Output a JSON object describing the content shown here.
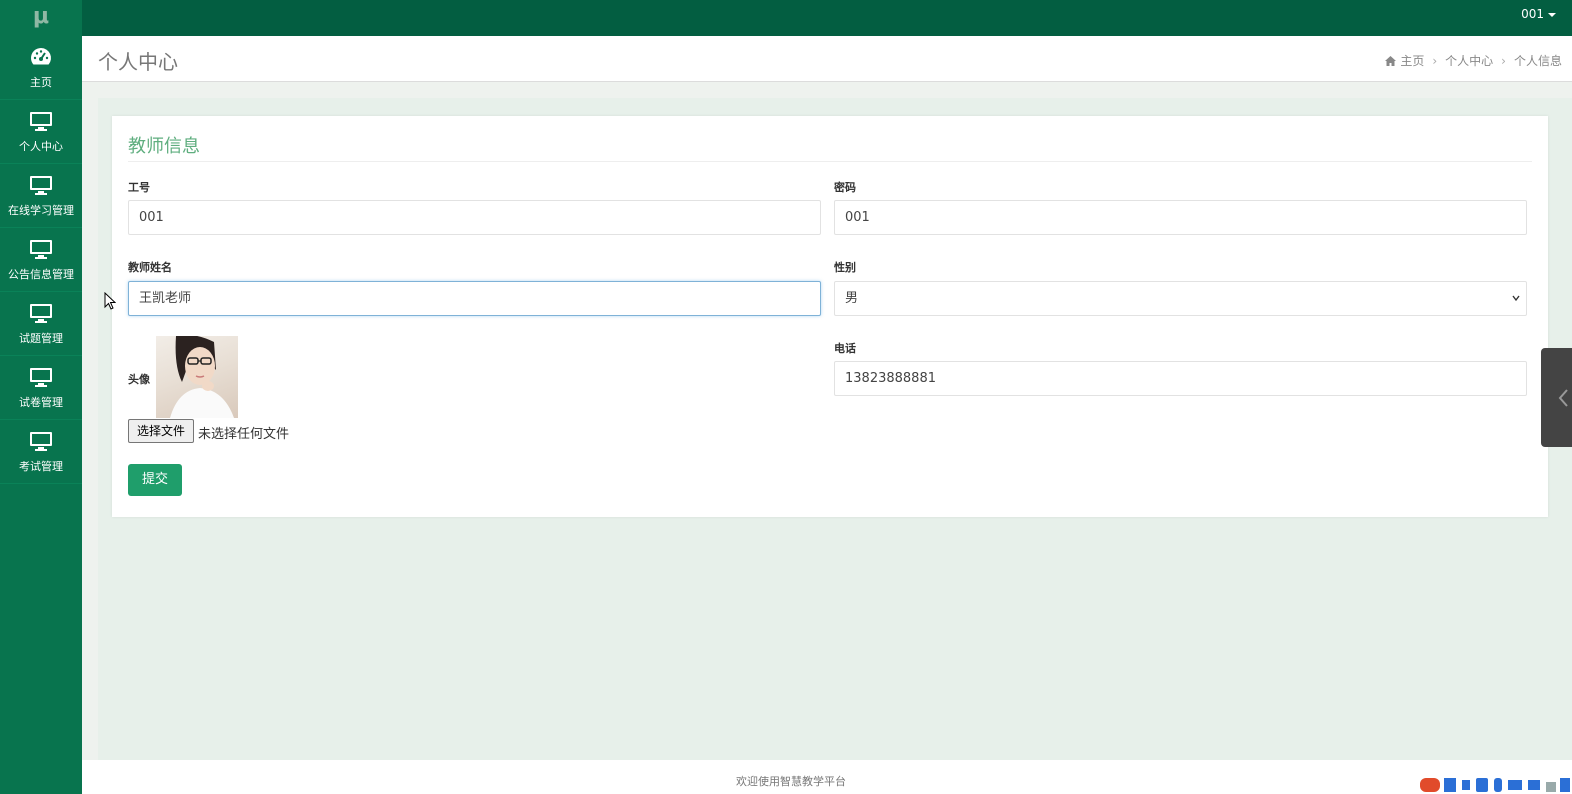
{
  "app": {
    "logo": "μ",
    "user_label": "001"
  },
  "colors": {
    "topbar": "#035e41",
    "sidebar": "#08744e",
    "accent": "#1f9e6b",
    "card_title": "#5fae7f"
  },
  "sidebar": {
    "items": [
      {
        "label": "主页",
        "icon": "dashboard-icon"
      },
      {
        "label": "个人中心",
        "icon": "monitor-icon"
      },
      {
        "label": "在线学习管理",
        "icon": "monitor-icon"
      },
      {
        "label": "公告信息管理",
        "icon": "monitor-icon"
      },
      {
        "label": "试题管理",
        "icon": "monitor-icon"
      },
      {
        "label": "试卷管理",
        "icon": "monitor-icon"
      },
      {
        "label": "考试管理",
        "icon": "monitor-icon"
      }
    ]
  },
  "header": {
    "title": "个人中心",
    "breadcrumb": [
      "主页",
      "个人中心",
      "个人信息"
    ]
  },
  "form": {
    "title": "教师信息",
    "job_id": {
      "label": "工号",
      "value": "001"
    },
    "password": {
      "label": "密码",
      "value": "001"
    },
    "name": {
      "label": "教师姓名",
      "value": "王凯老师"
    },
    "gender": {
      "label": "性别",
      "value": "男"
    },
    "avatar": {
      "label": "头像"
    },
    "file": {
      "button": "选择文件",
      "status": "未选择任何文件"
    },
    "phone": {
      "label": "电话",
      "value": "13823888881"
    },
    "submit": "提交"
  },
  "footer": {
    "text": "欢迎使用智慧教学平台"
  }
}
